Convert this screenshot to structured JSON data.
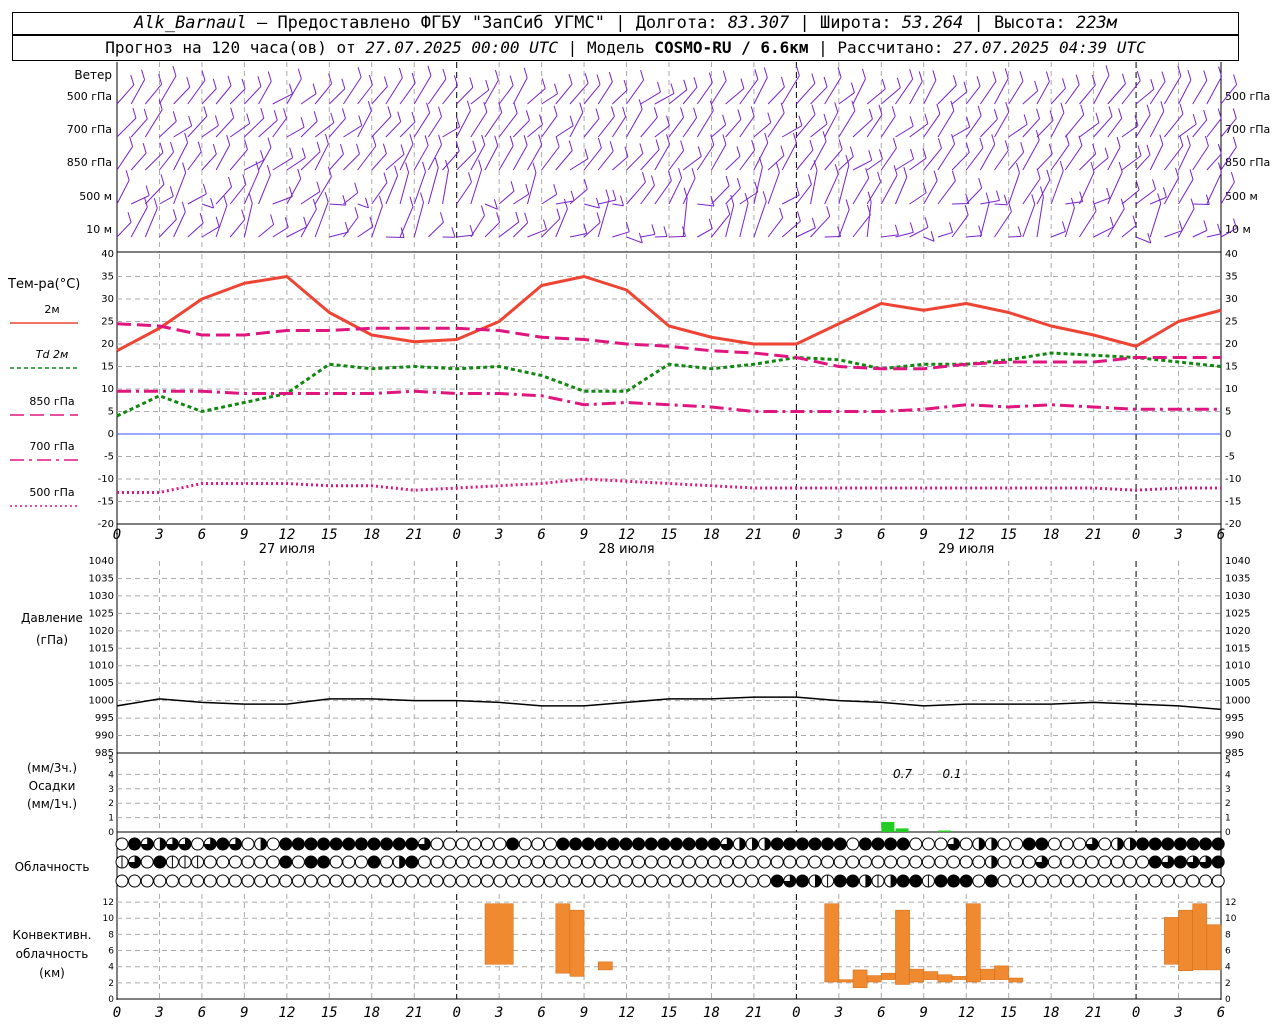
{
  "header": {
    "station": "Alk_Barnaul",
    "provider": "— Предоставлено ФГБУ \"ЗапСиб УГМС\"",
    "lon_label": "Долгота:",
    "lon": "83.307",
    "lat_label": "Широта:",
    "lat": "53.264",
    "alt_label": "Высота:",
    "alt": "223м",
    "forecast_label": "Прогноз на 120 часа(ов) от",
    "forecast_from": "27.07.2025 00:00 UTC",
    "model_label": "Модель",
    "model": "COSMO-RU / 6.6км",
    "calc_label": "Рассчитано:",
    "calc_time": "27.07.2025 04:39 UTC"
  },
  "chart_data": [
    {
      "type": "wind_barbs",
      "title": "Ветер",
      "levels": [
        "500 гПа",
        "700 гПа",
        "850 гПа",
        "500 м",
        "10  м"
      ]
    },
    {
      "type": "line",
      "title": "Тем-ра(°C)",
      "ylim": [
        -20,
        40
      ],
      "yticks": [
        -20,
        -15,
        -10,
        -5,
        0,
        5,
        10,
        15,
        20,
        25,
        30,
        35,
        40
      ],
      "x_hours": [
        0,
        3,
        6,
        9,
        12,
        15,
        18,
        21,
        24,
        27,
        30,
        33,
        36,
        39,
        42,
        45,
        48,
        51,
        54,
        57,
        60,
        63,
        66,
        69,
        72,
        75,
        78
      ],
      "x_ticks": [
        "0",
        "3",
        "6",
        "9",
        "12",
        "15",
        "18",
        "21",
        "0",
        "3",
        "6",
        "9",
        "12",
        "15",
        "18",
        "21",
        "0",
        "3",
        "6",
        "9",
        "12",
        "15",
        "18",
        "21",
        "0",
        "3",
        "6"
      ],
      "dates": [
        "27 июля",
        "28 июля",
        "29 июля"
      ],
      "series": [
        {
          "name": "2м",
          "color": "#ee4433",
          "dash": "",
          "values": [
            18.5,
            23.5,
            30,
            33.5,
            35,
            27,
            22,
            20.5,
            21,
            25,
            33,
            35,
            32,
            24,
            21.5,
            20,
            20,
            24.5,
            29,
            27.5,
            29,
            27,
            24,
            22,
            19.5,
            25,
            27.5
          ]
        },
        {
          "name": "Td  2м",
          "color": "#118811",
          "dash": "4,3",
          "values": [
            4,
            8.5,
            5,
            7,
            9,
            15.5,
            14.5,
            15,
            14.5,
            15,
            13,
            9.5,
            9.5,
            15.5,
            14.5,
            15.5,
            17,
            16.5,
            14.5,
            15.5,
            15.5,
            16.5,
            18,
            17.5,
            17,
            16,
            15
          ]
        },
        {
          "name": "850 гПа",
          "color": "#e0157f",
          "dash": "14,6",
          "values": [
            24.5,
            24,
            22,
            22,
            23,
            23,
            23.5,
            23.5,
            23.5,
            23,
            21.5,
            21,
            20,
            19.5,
            18.5,
            18,
            17,
            15,
            14.5,
            14.5,
            15.5,
            16,
            16,
            16,
            17,
            17,
            17
          ]
        },
        {
          "name": "700 гПа",
          "color": "#e0157f",
          "dash": "14,5,3,5",
          "values": [
            9.5,
            9.5,
            9.5,
            9,
            9,
            9,
            9,
            9.5,
            9,
            9,
            8.5,
            6.5,
            7,
            6.5,
            6,
            5,
            5,
            5,
            5,
            5.5,
            6.5,
            6,
            6.5,
            6,
            5.5,
            5.5,
            5.5
          ]
        },
        {
          "name": "500 гПа",
          "color": "#e0157f",
          "dash": "2,3",
          "values": [
            -13,
            -13,
            -11,
            -11,
            -11,
            -11.5,
            -11.5,
            -12.5,
            -12,
            -11.5,
            -11,
            -10,
            -10.5,
            -11,
            -11.5,
            -12,
            -12,
            -12,
            -12,
            -12,
            -12,
            -12,
            -12,
            -12,
            -12.5,
            -12,
            -12
          ]
        }
      ]
    },
    {
      "type": "line",
      "title": "Давление",
      "ylabel": "(гПа)",
      "ylim": [
        985,
        1040
      ],
      "yticks": [
        985,
        990,
        995,
        1000,
        1005,
        1010,
        1015,
        1020,
        1025,
        1030,
        1035,
        1040
      ],
      "x_hours": [
        0,
        3,
        6,
        9,
        12,
        15,
        18,
        21,
        24,
        27,
        30,
        33,
        36,
        39,
        42,
        45,
        48,
        51,
        54,
        57,
        60,
        63,
        66,
        69,
        72,
        75,
        78
      ],
      "values": [
        998.5,
        1000.5,
        999.5,
        999,
        999,
        1000.5,
        1000.5,
        1000,
        1000,
        999.5,
        998.5,
        998.5,
        999.5,
        1000.5,
        1000.5,
        1001,
        1001,
        1000,
        999.5,
        998.5,
        999,
        999,
        999,
        999.5,
        999,
        998.5,
        997.5
      ]
    },
    {
      "type": "bar",
      "title": "Осадки",
      "ylabel_top": "(мм/3ч.)",
      "ylabel_bottom": "(мм/1ч.)",
      "ylim": [
        0,
        5
      ],
      "yticks": [
        0,
        1,
        2,
        3,
        4,
        5
      ],
      "bars": [
        {
          "hour": 54.5,
          "value": 0.7
        },
        {
          "hour": 55.5,
          "value": 0.25
        },
        {
          "hour": 58.5,
          "value": 0.1
        }
      ],
      "labels": [
        {
          "hour": 55.5,
          "text": "0.7"
        },
        {
          "hour": 59,
          "text": "0.1"
        }
      ]
    },
    {
      "type": "cloud_symbols",
      "title": "Облачность",
      "rows": [
        "0432330343020444444444443000000400044444444444443222444444044440003022004400030224444444",
        "1304111000000404400040240000000000000000000000000000000000000000000002000300000000434334",
        "0000000000000000000000000000000000000000000000000000434214421244144404000000000000000000"
      ]
    },
    {
      "type": "bar",
      "title": "Конвективн. облачность",
      "ylabel": "(км)",
      "ylim": [
        0,
        13
      ],
      "yticks": [
        0,
        2,
        4,
        6,
        8,
        10,
        12
      ],
      "segments": [
        {
          "h0": 26,
          "h1": 28,
          "bottom": 4.3,
          "top": 11.8
        },
        {
          "h0": 31,
          "h1": 32,
          "bottom": 3.2,
          "top": 11.8
        },
        {
          "h0": 32,
          "h1": 33,
          "bottom": 2.8,
          "top": 11
        },
        {
          "h0": 34,
          "h1": 35,
          "bottom": 3.6,
          "top": 4.6
        },
        {
          "h0": 50,
          "h1": 51,
          "bottom": 2.1,
          "top": 11.8
        },
        {
          "h0": 51,
          "h1": 52,
          "bottom": 2.1,
          "top": 2.4
        },
        {
          "h0": 52,
          "h1": 53,
          "bottom": 1.4,
          "top": 3.6
        },
        {
          "h0": 53,
          "h1": 54,
          "bottom": 2.1,
          "top": 2.9
        },
        {
          "h0": 54,
          "h1": 55,
          "bottom": 2.4,
          "top": 3.2
        },
        {
          "h0": 55,
          "h1": 56,
          "bottom": 1.8,
          "top": 11
        },
        {
          "h0": 56,
          "h1": 57,
          "bottom": 2.1,
          "top": 3.7
        },
        {
          "h0": 57,
          "h1": 58,
          "bottom": 2.4,
          "top": 3.4
        },
        {
          "h0": 58,
          "h1": 59,
          "bottom": 2.1,
          "top": 3.0
        },
        {
          "h0": 59,
          "h1": 60,
          "bottom": 2.4,
          "top": 2.8
        },
        {
          "h0": 60,
          "h1": 61,
          "bottom": 2.1,
          "top": 11.8
        },
        {
          "h0": 61,
          "h1": 62,
          "bottom": 2.4,
          "top": 3.7
        },
        {
          "h0": 62,
          "h1": 63,
          "bottom": 2.4,
          "top": 4.1
        },
        {
          "h0": 63,
          "h1": 64,
          "bottom": 2.1,
          "top": 2.6
        },
        {
          "h0": 74,
          "h1": 75,
          "bottom": 4.3,
          "top": 10.1
        },
        {
          "h0": 75,
          "h1": 76,
          "bottom": 3.5,
          "top": 11
        },
        {
          "h0": 76,
          "h1": 77,
          "bottom": 3.6,
          "top": 11.8
        },
        {
          "h0": 77,
          "h1": 78,
          "bottom": 3.6,
          "top": 9.2
        }
      ]
    }
  ]
}
